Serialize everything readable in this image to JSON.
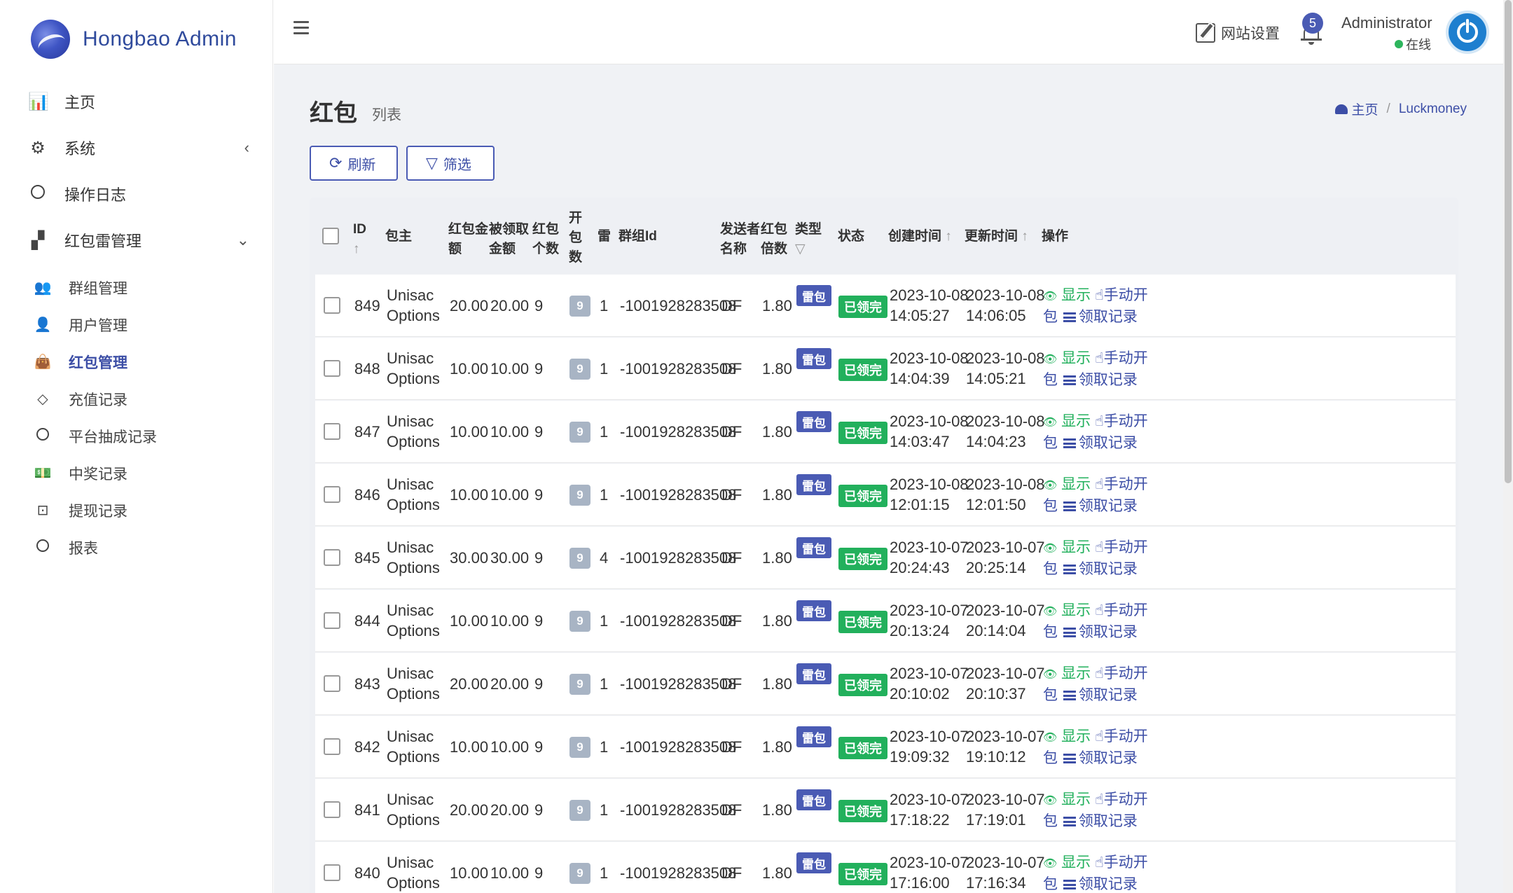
{
  "brand": {
    "name": "Hongbao Admin"
  },
  "sidebar": {
    "items": [
      {
        "label": "主页",
        "icon": "bar-chart-icon",
        "glyph": "📊"
      },
      {
        "label": "系统",
        "icon": "gear-icon",
        "glyph": "⚙",
        "caret": "‹"
      },
      {
        "label": "操作日志",
        "icon": "circle-icon"
      },
      {
        "label": "红包雷管理",
        "icon": "grid-icon",
        "glyph": "▞",
        "caret": "⌄"
      }
    ],
    "sub_items": [
      {
        "label": "群组管理",
        "icon": "users-icon",
        "glyph": "👥"
      },
      {
        "label": "用户管理",
        "icon": "user-icon",
        "glyph": "👤"
      },
      {
        "label": "红包管理",
        "icon": "shopping-bag-icon",
        "glyph": "👜",
        "active": true
      },
      {
        "label": "充值记录",
        "icon": "diamond-icon",
        "glyph": "◇"
      },
      {
        "label": "平台抽成记录",
        "icon": "circle-icon"
      },
      {
        "label": "中奖记录",
        "icon": "money-icon",
        "glyph": "💵"
      },
      {
        "label": "提现记录",
        "icon": "upload-box-icon",
        "glyph": "⊡"
      },
      {
        "label": "报表",
        "icon": "circle-icon"
      }
    ]
  },
  "topbar": {
    "site_settings": "网站设置",
    "notifications": "5",
    "user_name": "Administrator",
    "user_status": "在线"
  },
  "page": {
    "title": "红包",
    "subtitle": "列表"
  },
  "breadcrumb": {
    "home": "主页",
    "separator": "/",
    "current": "Luckmoney"
  },
  "toolbar": {
    "refresh": "刷新",
    "filter": "筛选"
  },
  "table": {
    "headers": {
      "id": "ID",
      "owner": "包主",
      "amount": "红包金额",
      "claimed": "被领取金额",
      "count": "红包个数",
      "opened": "开包数",
      "mine": "雷",
      "group_id": "群组Id",
      "sender": "发送者名称",
      "multiplier": "红包倍数",
      "type": "类型",
      "status": "状态",
      "created": "创建时间",
      "updated": "更新时间",
      "actions": "操作"
    },
    "action_labels": {
      "show": "显示",
      "manual_open": "手动开包",
      "claims": "领取记录"
    },
    "rows": [
      {
        "id": "849",
        "owner": "Unisac Options",
        "amount": "20.00",
        "claimed": "20.00",
        "count": "9",
        "opened": "9",
        "mine": "1",
        "group_id": "-1001928283508",
        "sender": "DF",
        "multiplier": "1.80",
        "type": "雷包",
        "status": "已领完",
        "created_date": "2023-10-08",
        "created_time": "14:05:27",
        "updated_date": "2023-10-08",
        "updated_time": "14:06:05"
      },
      {
        "id": "848",
        "owner": "Unisac Options",
        "amount": "10.00",
        "claimed": "10.00",
        "count": "9",
        "opened": "9",
        "mine": "1",
        "group_id": "-1001928283508",
        "sender": "DF",
        "multiplier": "1.80",
        "type": "雷包",
        "status": "已领完",
        "created_date": "2023-10-08",
        "created_time": "14:04:39",
        "updated_date": "2023-10-08",
        "updated_time": "14:05:21"
      },
      {
        "id": "847",
        "owner": "Unisac Options",
        "amount": "10.00",
        "claimed": "10.00",
        "count": "9",
        "opened": "9",
        "mine": "1",
        "group_id": "-1001928283508",
        "sender": "DF",
        "multiplier": "1.80",
        "type": "雷包",
        "status": "已领完",
        "created_date": "2023-10-08",
        "created_time": "14:03:47",
        "updated_date": "2023-10-08",
        "updated_time": "14:04:23"
      },
      {
        "id": "846",
        "owner": "Unisac Options",
        "amount": "10.00",
        "claimed": "10.00",
        "count": "9",
        "opened": "9",
        "mine": "1",
        "group_id": "-1001928283508",
        "sender": "DF",
        "multiplier": "1.80",
        "type": "雷包",
        "status": "已领完",
        "created_date": "2023-10-08",
        "created_time": "12:01:15",
        "updated_date": "2023-10-08",
        "updated_time": "12:01:50"
      },
      {
        "id": "845",
        "owner": "Unisac Options",
        "amount": "30.00",
        "claimed": "30.00",
        "count": "9",
        "opened": "9",
        "mine": "4",
        "group_id": "-1001928283508",
        "sender": "DF",
        "multiplier": "1.80",
        "type": "雷包",
        "status": "已领完",
        "created_date": "2023-10-07",
        "created_time": "20:24:43",
        "updated_date": "2023-10-07",
        "updated_time": "20:25:14"
      },
      {
        "id": "844",
        "owner": "Unisac Options",
        "amount": "10.00",
        "claimed": "10.00",
        "count": "9",
        "opened": "9",
        "mine": "1",
        "group_id": "-1001928283508",
        "sender": "DF",
        "multiplier": "1.80",
        "type": "雷包",
        "status": "已领完",
        "created_date": "2023-10-07",
        "created_time": "20:13:24",
        "updated_date": "2023-10-07",
        "updated_time": "20:14:04"
      },
      {
        "id": "843",
        "owner": "Unisac Options",
        "amount": "20.00",
        "claimed": "20.00",
        "count": "9",
        "opened": "9",
        "mine": "1",
        "group_id": "-1001928283508",
        "sender": "DF",
        "multiplier": "1.80",
        "type": "雷包",
        "status": "已领完",
        "created_date": "2023-10-07",
        "created_time": "20:10:02",
        "updated_date": "2023-10-07",
        "updated_time": "20:10:37"
      },
      {
        "id": "842",
        "owner": "Unisac Options",
        "amount": "10.00",
        "claimed": "10.00",
        "count": "9",
        "opened": "9",
        "mine": "1",
        "group_id": "-1001928283508",
        "sender": "DF",
        "multiplier": "1.80",
        "type": "雷包",
        "status": "已领完",
        "created_date": "2023-10-07",
        "created_time": "19:09:32",
        "updated_date": "2023-10-07",
        "updated_time": "19:10:12"
      },
      {
        "id": "841",
        "owner": "Unisac Options",
        "amount": "20.00",
        "claimed": "20.00",
        "count": "9",
        "opened": "9",
        "mine": "1",
        "group_id": "-1001928283508",
        "sender": "DF",
        "multiplier": "1.80",
        "type": "雷包",
        "status": "已领完",
        "created_date": "2023-10-07",
        "created_time": "17:18:22",
        "updated_date": "2023-10-07",
        "updated_time": "17:19:01"
      },
      {
        "id": "840",
        "owner": "Unisac Options",
        "amount": "10.00",
        "claimed": "10.00",
        "count": "9",
        "opened": "9",
        "mine": "1",
        "group_id": "-1001928283508",
        "sender": "DF",
        "multiplier": "1.80",
        "type": "雷包",
        "status": "已领完",
        "created_date": "2023-10-07",
        "created_time": "17:16:00",
        "updated_date": "2023-10-07",
        "updated_time": "17:16:34"
      }
    ]
  },
  "colors": {
    "primary": "#4a5bb4",
    "success": "#22b05c",
    "badge_gray": "#a8b4c4"
  }
}
